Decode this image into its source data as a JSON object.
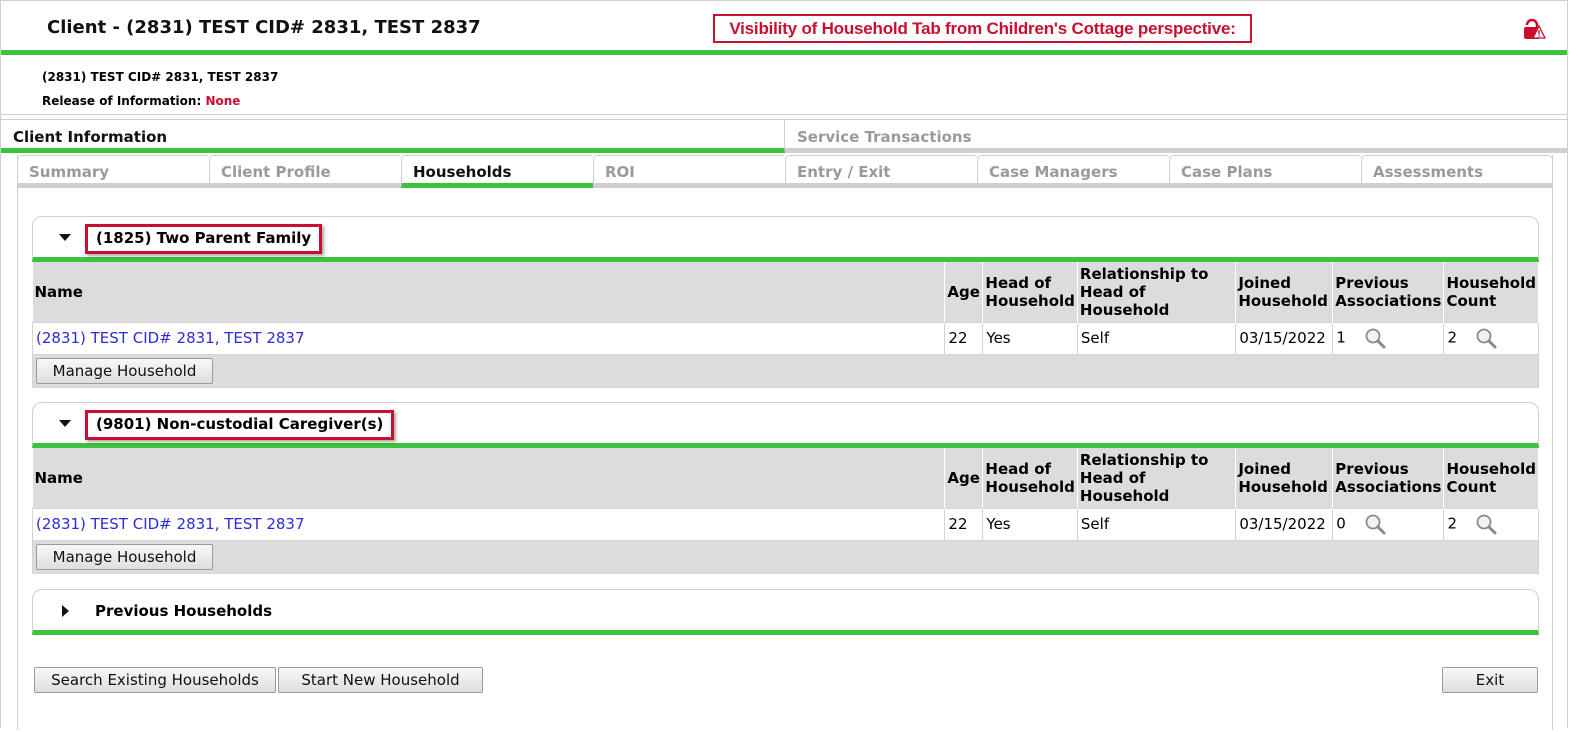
{
  "header": {
    "title": "Client - (2831) TEST CID# 2831, TEST 2837",
    "banner": "Visibility of Household Tab from Children's Cottage perspective:",
    "lock_icon": "lock-alert-icon"
  },
  "client": {
    "name_line": "(2831) TEST CID# 2831, TEST 2837",
    "roi_label": "Release of Information: ",
    "roi_value": "None",
    "roi_color": "#c8102e"
  },
  "top_tabs": [
    {
      "label": "Client Information",
      "active": true
    },
    {
      "label": "Service Transactions",
      "active": false
    }
  ],
  "inner_tabs": [
    {
      "label": "Summary",
      "active": false
    },
    {
      "label": "Client Profile",
      "active": false
    },
    {
      "label": "Households",
      "active": true
    },
    {
      "label": "ROI",
      "active": false
    },
    {
      "label": "Entry / Exit",
      "active": false
    },
    {
      "label": "Case Managers",
      "active": false
    },
    {
      "label": "Case Plans",
      "active": false
    },
    {
      "label": "Assessments",
      "active": false
    }
  ],
  "columns": [
    "Name",
    "Age",
    "Head of Household",
    "Relationship to Head of Household",
    "Joined Household",
    "Previous Associations",
    "Household Count"
  ],
  "households": [
    {
      "title": "(1825) Two Parent Family",
      "rows": [
        {
          "name": "(2831) TEST CID# 2831, TEST 2837",
          "age": "22",
          "head": "Yes",
          "relationship": "Self",
          "joined": "03/15/2022",
          "previous": "1",
          "count": "2"
        }
      ],
      "button": "Manage Household"
    },
    {
      "title": "(9801) Non-custodial Caregiver(s)",
      "rows": [
        {
          "name": "(2831) TEST CID# 2831, TEST 2837",
          "age": "22",
          "head": "Yes",
          "relationship": "Self",
          "joined": "03/15/2022",
          "previous": "0",
          "count": "2"
        }
      ],
      "button": "Manage Household"
    }
  ],
  "previous_households": {
    "title": "Previous Households"
  },
  "footer": {
    "search_button": "Search Existing Households",
    "new_button": "Start New Household",
    "exit_button": "Exit"
  },
  "colors": {
    "accent_green": "#3cc23c",
    "highlight_red": "#c8102e",
    "link_blue": "#2c2cd6"
  }
}
